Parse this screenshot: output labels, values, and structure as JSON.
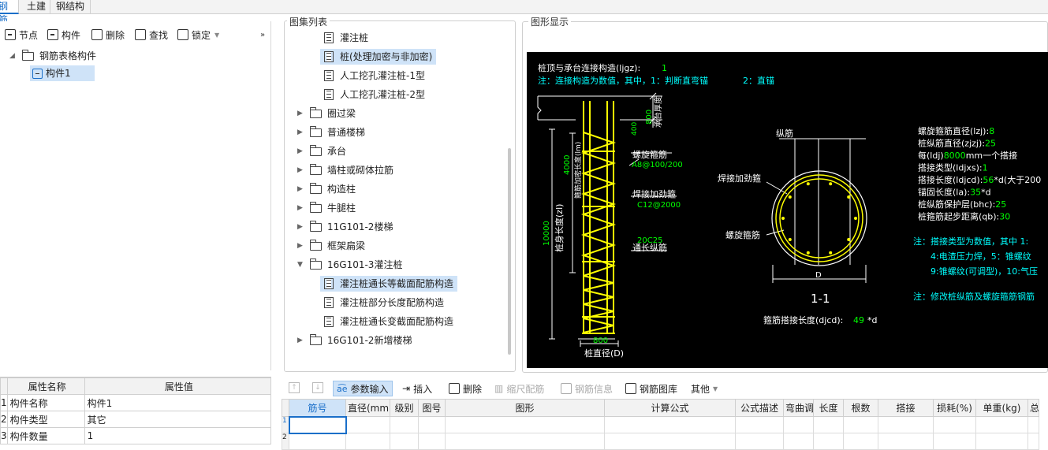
{
  "tabs": [
    "钢筋",
    "土建",
    "钢结构"
  ],
  "left_toolbar": {
    "node": "节点",
    "component": "构件",
    "delete": "删除",
    "find": "查找",
    "lock": "锁定"
  },
  "tree": {
    "root": "钢筋表格构件",
    "child": "构件1"
  },
  "props": {
    "headers": [
      "属性名称",
      "属性值"
    ],
    "rows": [
      {
        "num": "1",
        "name": "构件名称",
        "value": "构件1"
      },
      {
        "num": "2",
        "name": "构件类型",
        "value": "其它"
      },
      {
        "num": "3",
        "name": "构件数量",
        "value": "1"
      }
    ]
  },
  "atlas": {
    "title": "图集列表",
    "items": [
      {
        "label": "灌注桩",
        "kind": "doc",
        "level": 2,
        "selected": false
      },
      {
        "label": "桩(处理加密与非加密)",
        "kind": "doc",
        "level": 2,
        "selected": true
      },
      {
        "label": "人工挖孔灌注桩-1型",
        "kind": "doc",
        "level": 2,
        "selected": false
      },
      {
        "label": "人工挖孔灌注桩-2型",
        "kind": "doc",
        "level": 2,
        "selected": false
      },
      {
        "label": "圈过梁",
        "kind": "folder",
        "level": 1,
        "open": false
      },
      {
        "label": "普通楼梯",
        "kind": "folder",
        "level": 1,
        "open": false
      },
      {
        "label": "承台",
        "kind": "folder",
        "level": 1,
        "open": false
      },
      {
        "label": "墙柱或砌体拉筋",
        "kind": "folder",
        "level": 1,
        "open": false
      },
      {
        "label": "构造柱",
        "kind": "folder",
        "level": 1,
        "open": false
      },
      {
        "label": "牛腿柱",
        "kind": "folder",
        "level": 1,
        "open": false
      },
      {
        "label": "11G101-2楼梯",
        "kind": "folder",
        "level": 1,
        "open": false
      },
      {
        "label": "框架扁梁",
        "kind": "folder",
        "level": 1,
        "open": false
      },
      {
        "label": "16G101-3灌注桩",
        "kind": "folder",
        "level": 1,
        "open": true
      },
      {
        "label": "灌注桩通长等截面配筋构造",
        "kind": "doc",
        "level": 2,
        "selected": true
      },
      {
        "label": "灌注桩部分长度配筋构造",
        "kind": "doc",
        "level": 2,
        "selected": false
      },
      {
        "label": "灌注桩通长变截面配筋构造",
        "kind": "doc",
        "level": 2,
        "selected": false
      },
      {
        "label": "16G101-2新增楼梯",
        "kind": "folder",
        "level": 1,
        "open": false
      }
    ]
  },
  "drawing": {
    "title": "图形显示",
    "line1_label": "桩顶与承台连接构造(ljgz):",
    "line1_value": "1",
    "note1": "注：连接构造为数值，其中，1：判断直弯锚",
    "note1b": "2：直锚",
    "dim_800_top": "800",
    "cap_label": "承台厚度",
    "dense_label": "箍筋加密长度(lm)",
    "dim_4000": "4000",
    "dim_10000": "10000",
    "pile_len_label": "桩身长度(zl)",
    "val_400": "400",
    "spiral_label": "螺旋箍筋",
    "spiral_value": "A8@100/200",
    "weld_label": "焊接加劲箍",
    "weld_value": "C12@2000",
    "main_count": "20C25",
    "through_label": "通长纵筋",
    "dim_800_bottom": "800",
    "diameter_label": "桩直径(D)",
    "sec_zongjin": "纵筋",
    "sec_weld": "焊接加劲箍",
    "sec_spiral": "螺旋箍筋",
    "sec_D": "D",
    "sec_title": "1-1",
    "hoop_overlap_label": "箍筋搭接长度(djcd):",
    "hoop_overlap_value": "49",
    "hoop_overlap_unit": "*d",
    "params": [
      {
        "label": "螺旋箍筋直径(lzj):",
        "value": "8",
        "suffix": ""
      },
      {
        "label": "桩纵筋直径(zjzj):",
        "value": "25",
        "suffix": ""
      },
      {
        "label": "每(ldj)",
        "value": "8000",
        "suffix": "mm一个搭接"
      },
      {
        "label": "搭接类型(ldjxs):",
        "value": "1",
        "suffix": ""
      },
      {
        "label": "搭接长度(ldjcd):",
        "value": "56",
        "suffix": "*d(大于200"
      },
      {
        "label": "锚固长度(la):",
        "value": "35",
        "suffix": "*d"
      },
      {
        "label": "桩纵筋保护层(bhc):",
        "value": "25",
        "suffix": ""
      },
      {
        "label": "桩箍筋起步距离(qb):",
        "value": "30",
        "suffix": ""
      }
    ],
    "note2": "注：搭接类型为数值，其中 1:",
    "note2b": "4:电渣压力焊，5：锥螺纹",
    "note2c": "9:锥螺纹(可调型)，10:气压",
    "note3": "注：修改桩纵筋及螺旋箍筋钢筋"
  },
  "bottom_toolbar": {
    "param_input": "参数输入",
    "insert": "插入",
    "delete": "删除",
    "scale": "缩尺配筋",
    "info": "钢筋信息",
    "library": "钢筋图库",
    "other": "其他"
  },
  "grid": {
    "headers": [
      "筋号",
      "直径(mm)",
      "级别",
      "图号",
      "图形",
      "计算公式",
      "公式描述",
      "弯曲调整",
      "长度",
      "根数",
      "搭接",
      "损耗(%)",
      "单重(kg)",
      "总"
    ],
    "row_numbers": [
      "1",
      "2"
    ]
  },
  "colors": {
    "accent": "#1a6fc9",
    "selection": "#cfe3f8",
    "cad_yellow": "#ffff00",
    "cad_green": "#00ff00",
    "cad_cyan": "#00ffff",
    "cad_white": "#ffffff"
  }
}
